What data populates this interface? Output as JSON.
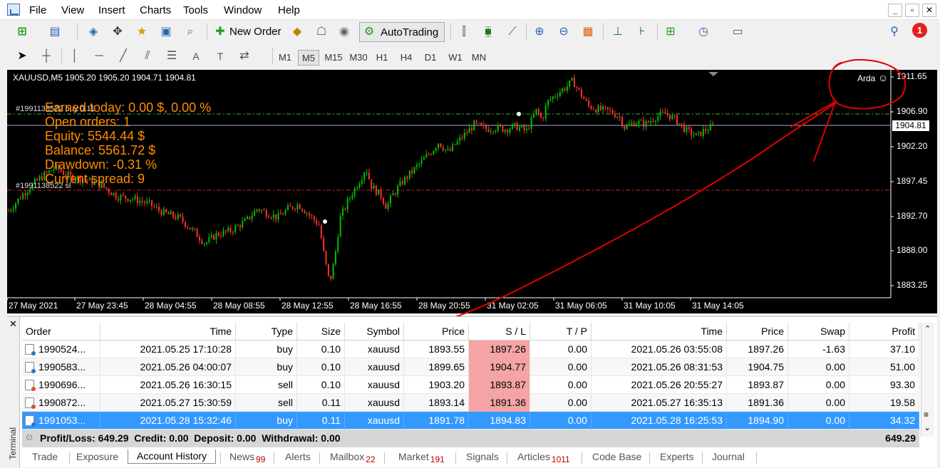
{
  "menu": [
    "File",
    "View",
    "Insert",
    "Charts",
    "Tools",
    "Window",
    "Help"
  ],
  "toolbar": {
    "new_order_label": "New Order",
    "autotrading_label": "AutoTrading",
    "notification_count": "1",
    "timeframes": [
      "M1",
      "M5",
      "M15",
      "M30",
      "H1",
      "H4",
      "D1",
      "W1",
      "MN"
    ],
    "active_timeframe": "M5"
  },
  "chart": {
    "header": "XAUUSD,M5  1905.20 1905.20 1904.71 1904.81",
    "expert_name": "Arda",
    "order_line_tp": "#1991138522 buy 0.11",
    "order_line_sl": "#1991138522 sl",
    "current_price": "1904.81",
    "info": {
      "earned": "Earned today: 0.00 $, 0.00 %",
      "open_orders": "Open orders: 1",
      "equity": "Equity: 5544.44 $",
      "balance": "Balance: 5561.72 $",
      "drawdown": "Drawdown: -0.31 %",
      "spread": "Current spread: 9"
    },
    "colors": {
      "bull": "#00c000",
      "bear": "#ff3030",
      "text_overlay": "#ff8c00",
      "annotation": "#e00000"
    }
  },
  "chart_data": {
    "type": "candlestick",
    "symbol": "XAUUSD",
    "timeframe": "M5",
    "y_ticks": [
      "1911.65",
      "1906.90",
      "1902.20",
      "1897.45",
      "1892.70",
      "1888.00",
      "1883.25"
    ],
    "x_ticks": [
      "27 May 2021",
      "27 May 23:45",
      "28 May 04:55",
      "28 May 08:55",
      "28 May 12:55",
      "28 May 16:55",
      "28 May 20:55",
      "31 May 02:05",
      "31 May 06:05",
      "31 May 10:05",
      "31 May 14:05"
    ],
    "ylim": [
      1881.5,
      1913.0
    ],
    "path": [
      [
        0,
        1893.5
      ],
      [
        3,
        1896
      ],
      [
        6,
        1898
      ],
      [
        9,
        1899.5
      ],
      [
        12,
        1898.2
      ],
      [
        15,
        1897.8
      ],
      [
        18,
        1897
      ],
      [
        21,
        1895.5
      ],
      [
        24,
        1895.2
      ],
      [
        27,
        1894.5
      ],
      [
        30,
        1893.2
      ],
      [
        33,
        1892.5
      ],
      [
        36,
        1890.5
      ],
      [
        38,
        1889
      ],
      [
        40,
        1890.2
      ],
      [
        43,
        1890.8
      ],
      [
        46,
        1892.2
      ],
      [
        48,
        1893.8
      ],
      [
        50,
        1893.2
      ],
      [
        52,
        1892.6
      ],
      [
        54,
        1893.8
      ],
      [
        56,
        1894.4
      ],
      [
        58,
        1893
      ],
      [
        60,
        1891.5
      ],
      [
        61,
        1887
      ],
      [
        62,
        1883.5
      ],
      [
        63,
        1887
      ],
      [
        64,
        1892.5
      ],
      [
        66,
        1895.5
      ],
      [
        68,
        1898
      ],
      [
        69,
        1899.5
      ],
      [
        70,
        1897
      ],
      [
        72,
        1895.5
      ],
      [
        73,
        1894
      ],
      [
        74,
        1895.5
      ],
      [
        76,
        1897.5
      ],
      [
        78,
        1899
      ],
      [
        80,
        1900.5
      ],
      [
        82,
        1902
      ],
      [
        83,
        1903
      ],
      [
        85,
        1901.5
      ],
      [
        86,
        1902.5
      ],
      [
        88,
        1904
      ],
      [
        90,
        1905.5
      ],
      [
        92,
        1904.8
      ],
      [
        94,
        1905
      ],
      [
        96,
        1904.8
      ],
      [
        98,
        1905.2
      ],
      [
        100,
        1904.5
      ],
      [
        101,
        1906
      ],
      [
        102,
        1907.5
      ],
      [
        103,
        1906
      ],
      [
        104,
        1908.5
      ],
      [
        106,
        1909.8
      ],
      [
        108,
        1910.8
      ],
      [
        109,
        1911.5
      ],
      [
        110,
        1910.2
      ],
      [
        112,
        1908
      ],
      [
        114,
        1907.5
      ],
      [
        116,
        1907.3
      ],
      [
        118,
        1906.5
      ],
      [
        119,
        1905
      ],
      [
        121,
        1905.8
      ],
      [
        123,
        1905.5
      ],
      [
        125,
        1906.5
      ],
      [
        127,
        1907
      ],
      [
        129,
        1906
      ],
      [
        131,
        1904.5
      ],
      [
        133,
        1903.8
      ],
      [
        134,
        1904.5
      ],
      [
        136,
        1905.2
      ]
    ]
  },
  "terminal": {
    "side_label": "Terminal",
    "columns": [
      "Order",
      "Time",
      "Type",
      "Size",
      "Symbol",
      "Price",
      "S / L",
      "T / P",
      "Time",
      "Price",
      "Swap",
      "Profit"
    ],
    "rows": [
      {
        "order": "1990524...",
        "time": "2021.05.25 17:10:28",
        "type": "buy",
        "size": "0.10",
        "symbol": "xauusd",
        "price": "1893.55",
        "sl": "1897.26",
        "tp": "0.00",
        "close_time": "2021.05.26 03:55:08",
        "close_price": "1897.26",
        "swap": "-1.63",
        "profit": "37.10",
        "kind": "buy"
      },
      {
        "order": "1990583...",
        "time": "2021.05.26 04:00:07",
        "type": "buy",
        "size": "0.10",
        "symbol": "xauusd",
        "price": "1899.65",
        "sl": "1904.77",
        "tp": "0.00",
        "close_time": "2021.05.26 08:31:53",
        "close_price": "1904.75",
        "swap": "0.00",
        "profit": "51.00",
        "kind": "buy"
      },
      {
        "order": "1990696...",
        "time": "2021.05.26 16:30:15",
        "type": "sell",
        "size": "0.10",
        "symbol": "xauusd",
        "price": "1903.20",
        "sl": "1893.87",
        "tp": "0.00",
        "close_time": "2021.05.26 20:55:27",
        "close_price": "1893.87",
        "swap": "0.00",
        "profit": "93.30",
        "kind": "sell"
      },
      {
        "order": "1990872...",
        "time": "2021.05.27 15:30:59",
        "type": "sell",
        "size": "0.11",
        "symbol": "xauusd",
        "price": "1893.14",
        "sl": "1891.36",
        "tp": "0.00",
        "close_time": "2021.05.27 16:35:13",
        "close_price": "1891.36",
        "swap": "0.00",
        "profit": "19.58",
        "kind": "sell"
      },
      {
        "order": "1991053...",
        "time": "2021.05.28 15:32:46",
        "type": "buy",
        "size": "0.11",
        "symbol": "xauusd",
        "price": "1891.78",
        "sl": "1894.83",
        "tp": "0.00",
        "close_time": "2021.05.28 16:25:53",
        "close_price": "1894.90",
        "swap": "0.00",
        "profit": "34.32",
        "kind": "buy",
        "selected": true
      }
    ],
    "summary": "Profit/Loss: 649.29  Credit: 0.00  Deposit: 0.00  Withdrawal: 0.00",
    "summary_total": "649.29",
    "tabs": [
      {
        "label": "Trade",
        "count": ""
      },
      {
        "label": "Exposure",
        "count": ""
      },
      {
        "label": "Account History",
        "count": "",
        "active": true
      },
      {
        "label": "News",
        "count": "99"
      },
      {
        "label": "Alerts",
        "count": ""
      },
      {
        "label": "Mailbox",
        "count": "22"
      },
      {
        "label": "Market",
        "count": "191"
      },
      {
        "label": "Signals",
        "count": ""
      },
      {
        "label": "Articles",
        "count": "1011"
      },
      {
        "label": "Code Base",
        "count": ""
      },
      {
        "label": "Experts",
        "count": ""
      },
      {
        "label": "Journal",
        "count": ""
      }
    ],
    "colors": {
      "selected_row": "#3399ff",
      "sl_highlight": "#f4a4a4",
      "summary_bg": "#d6d6d6"
    }
  }
}
